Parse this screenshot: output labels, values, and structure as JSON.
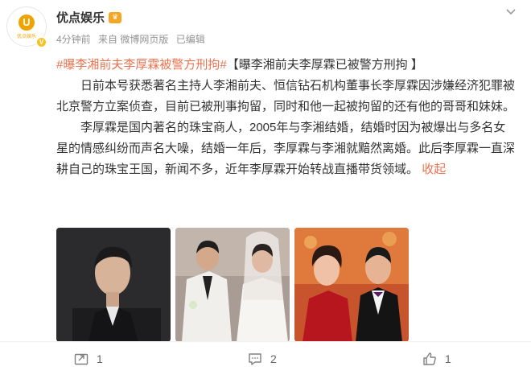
{
  "author": {
    "name": "优点娱乐",
    "avatar_text": "优点娱乐",
    "badge_icon": "crown-icon",
    "verified_icon": "verified-v-icon"
  },
  "meta": {
    "time": "4分钟前",
    "source": "来自 微博网页版",
    "edited": "已编辑"
  },
  "post": {
    "hashtag": "#曝李湘前夫李厚霖被警方刑拘#",
    "topic": "【曝李湘前夫李厚霖已被警方刑拘 】",
    "paragraph1": "日前本号获悉著名主持人李湘前夫、恒信钻石机构董事长李厚霖因涉嫌经济犯罪被北京警方立案侦查，目前已被刑事拘留，同时和他一起被拘留的还有他的哥哥和妹妹。",
    "paragraph2": "李厚霖是国内著名的珠宝商人，2005年与李湘结婚，结婚时因为被爆出与多名女星的情感纠纷而声名大噪，结婚一年后，李厚霖与李湘就黯然离婚。此后李厚霖一直深耕自己的珠宝王国，新闻不多，近年李厚霖开始转战直播带货领域。",
    "collapse": "收起"
  },
  "images": [
    "portrait-photo",
    "wedding-photo",
    "couple-photo"
  ],
  "actions": {
    "repost_count": "1",
    "comment_count": "2",
    "like_count": "1"
  },
  "colors": {
    "accent": "#eb7350",
    "text": "#333333",
    "meta": "#939393"
  }
}
